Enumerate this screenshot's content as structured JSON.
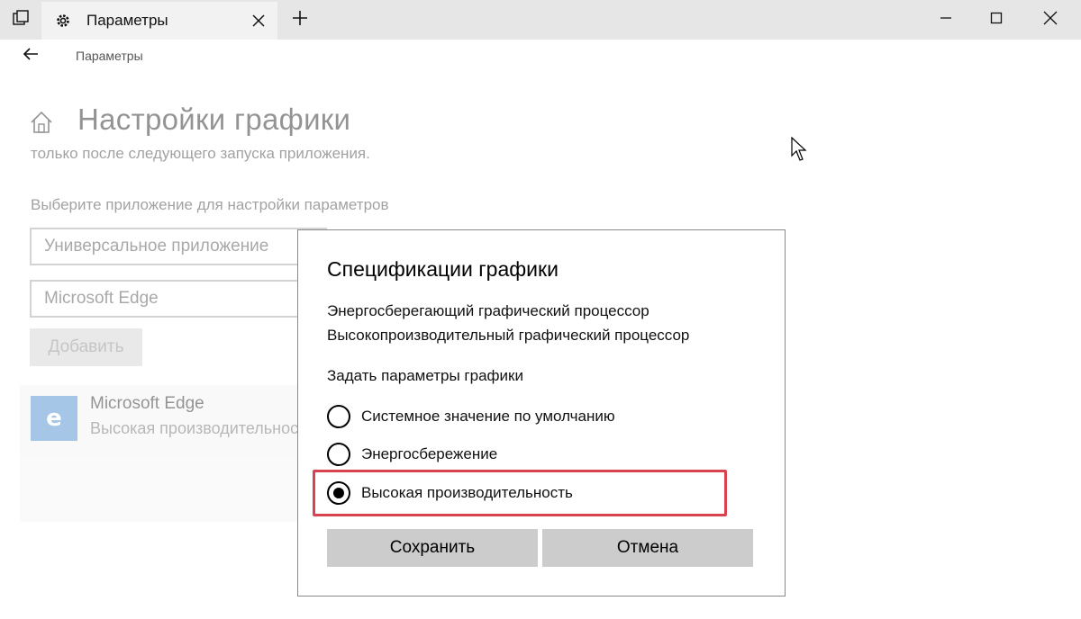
{
  "window": {
    "tab_title": "Параметры"
  },
  "breadcrumb": "Параметры",
  "page": {
    "title": "Настройки графики",
    "subtitle": "только после следующего запуска приложения.",
    "choose_label": "Выберите приложение для настройки параметров",
    "app_type_value": "Универсальное приложение",
    "app_value": "Microsoft Edge",
    "add_button": "Добавить",
    "app_card": {
      "name": "Microsoft Edge",
      "preference": "Высокая производительность"
    }
  },
  "dialog": {
    "title": "Спецификации графики",
    "gpu_power_saving": "Энергосберегающий графический процессор",
    "gpu_high_perf": "Высокопроизводительный графический процессор",
    "set_label": "Задать параметры графики",
    "options": [
      {
        "label": "Системное значение по умолчанию",
        "checked": false
      },
      {
        "label": "Энергосбережение",
        "checked": false
      },
      {
        "label": "Высокая производительность",
        "checked": true
      }
    ],
    "save_button": "Сохранить",
    "cancel_button": "Отмена"
  },
  "colors": {
    "highlight": "#d9434f",
    "edge_tile": "#2a79c8"
  }
}
